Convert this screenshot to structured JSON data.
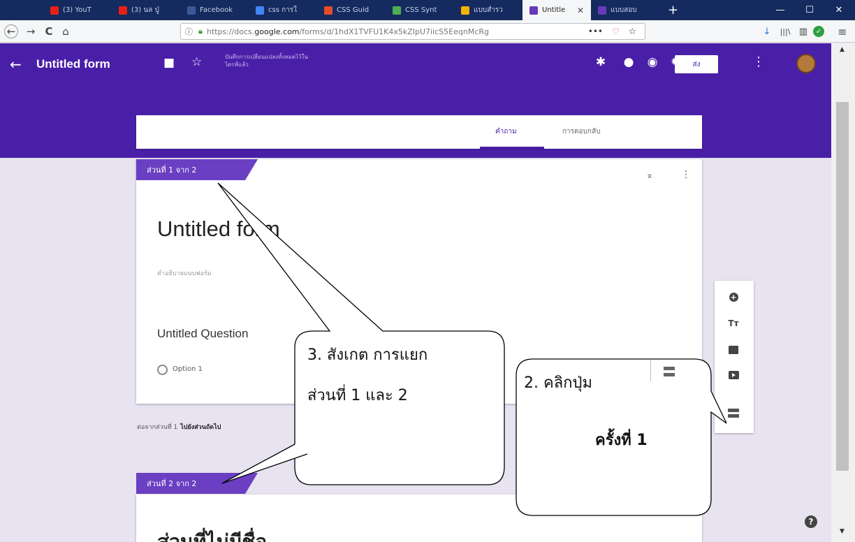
{
  "browser": {
    "tabs": [
      {
        "label": "(3) YouT",
        "icon": "youtube-icon",
        "color": "#e62117"
      },
      {
        "label": "(3) นล ปู่",
        "icon": "youtube-icon",
        "color": "#e62117"
      },
      {
        "label": "Facebook",
        "icon": "facebook-icon",
        "color": "#3b5998"
      },
      {
        "label": "css การใ",
        "icon": "google-icon",
        "color": "#4285f4"
      },
      {
        "label": "CSS Guid",
        "icon": "css-guide-icon",
        "color": "#e44d26"
      },
      {
        "label": "CSS Synt",
        "icon": "w3schools-icon",
        "color": "#4caf50"
      },
      {
        "label": "แบบสำรว",
        "icon": "google-drive-icon",
        "color": "#f4b400"
      },
      {
        "label": "Untitle",
        "icon": "google-forms-icon",
        "color": "#673ab7",
        "active": true
      },
      {
        "label": "แบบสอบ",
        "icon": "google-forms-icon",
        "color": "#673ab7"
      }
    ],
    "url": {
      "prefix": "https://docs.",
      "domain": "google.com",
      "path": "/forms/d/1hdX1TVFU1K4x5kZIpU7iicS5EeqnMcRg"
    },
    "nav": {
      "back": "←",
      "forward": "→",
      "reload": "C",
      "home": "⌂"
    },
    "url_actions": {
      "more": "•••",
      "pocket": "♡",
      "star": "☆"
    },
    "tools": {
      "download": "↓",
      "library": "|||\\",
      "sidebar": "▥",
      "check": "✓",
      "menu": "≡"
    },
    "window": {
      "min": "—",
      "max": "☐",
      "close": "✕"
    }
  },
  "header": {
    "back": "←",
    "title": "Untitled form",
    "folder": "■",
    "star": "☆",
    "save_status": "บันทึกการเปลี่ยนแปลงทั้งหมดไว้ในไดรฟ์แล้ว",
    "addons_icon": "✱",
    "palette_icon": "●",
    "preview_icon": "◉",
    "settings_icon": "✹",
    "send_label": "ส่ง",
    "more_icon": "⋮"
  },
  "tabs": {
    "questions": "คำถาม",
    "responses": "การตอบกลับ"
  },
  "section1": {
    "tag": "ส่วนที่ 1 จาก 2",
    "collapse": "⌅",
    "more": "⋮",
    "form_title": "Untitled form",
    "form_desc": "คำอธิบายแบบฟอร์ม",
    "question": "Untitled Question",
    "option": "Option 1"
  },
  "after_section": {
    "label": "ต่อจากส่วนที่ 1",
    "value": "ไปยังส่วนถัดไป"
  },
  "section2": {
    "tag": "ส่วนที่ 2 จาก 2",
    "title": "ส่วนที่ไม่มีชื่อ"
  },
  "toolbar": {
    "add": "+",
    "title_text": "Tт"
  },
  "help": "?",
  "callouts": {
    "c3_line1": "3. สังเกต การแยก",
    "c3_line2": "ส่วนที่ 1 และ 2",
    "c2_line1": "2. คลิกปุ่ม",
    "c2_line2": "ครั้งที่ 1"
  },
  "colors": {
    "header": "#4a1fa8",
    "section_tag": "#6a3fc2",
    "page_bg": "#e8e3f1"
  }
}
